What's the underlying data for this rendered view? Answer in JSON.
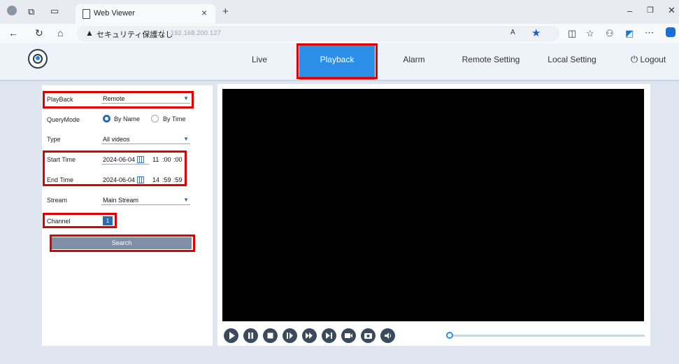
{
  "browser": {
    "tab_title": "Web Viewer",
    "new_tab_icon": "plus-icon",
    "security_text": "セキュリティ保護なし",
    "separator": "|",
    "host": "192.168.200.127"
  },
  "nav": {
    "items": [
      {
        "label": "Live"
      },
      {
        "label": "Playback"
      },
      {
        "label": "Alarm"
      },
      {
        "label": "Remote Setting"
      },
      {
        "label": "Local Setting"
      }
    ],
    "logout_label": "Logout",
    "accent": "#2b8fe8"
  },
  "form": {
    "playback_label": "PlayBack",
    "playback_value": "Remote",
    "querymode_label": "QueryMode",
    "by_name_label": "By Name",
    "by_time_label": "By Time",
    "type_label": "Type",
    "type_value": "All videos",
    "start_label": "Start Time",
    "start_date": "2024-06-04",
    "start_h": "11",
    "start_m": ":00",
    "start_s": ":00",
    "end_label": "End Time",
    "end_date": "2024-06-04",
    "end_h": "14",
    "end_m": ":59",
    "end_s": ":59",
    "stream_label": "Stream",
    "stream_value": "Main Stream",
    "channel_label": "Channel",
    "channel_value": "1",
    "search_label": "Search"
  },
  "player": {
    "controls": [
      "play-icon",
      "pause-icon",
      "stop-icon",
      "slow-icon",
      "fast-icon",
      "next-frame-icon",
      "record-icon",
      "snapshot-icon",
      "volume-icon"
    ],
    "progress": 0
  },
  "colors": {
    "highlight": "#e00000",
    "video_bg": "#000000"
  }
}
